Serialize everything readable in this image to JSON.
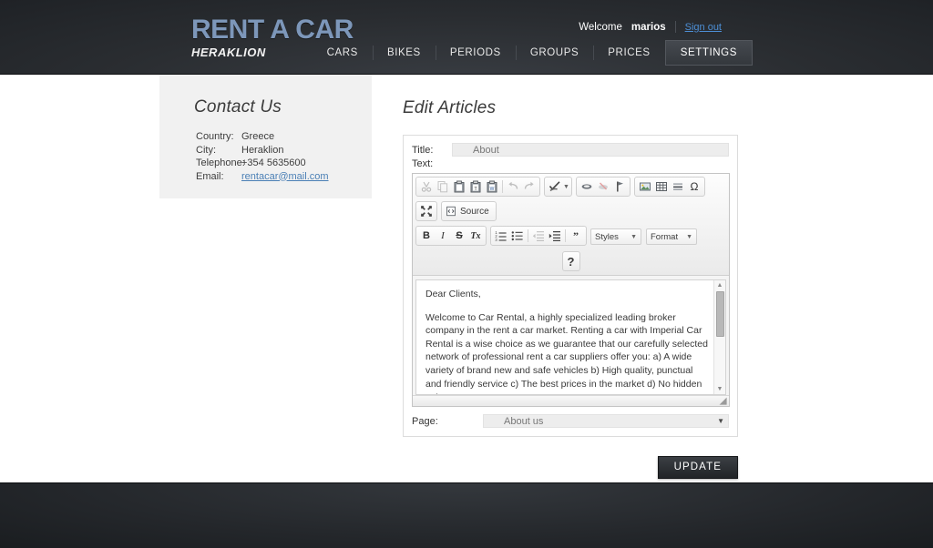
{
  "header": {
    "logo_main": "RENT A CAR",
    "logo_sub": "HERAKLION",
    "welcome_text": "Welcome",
    "welcome_user": "marios",
    "signout_label": "Sign out",
    "nav": [
      {
        "label": "CARS",
        "active": false
      },
      {
        "label": "BIKES",
        "active": false
      },
      {
        "label": "PERIODS",
        "active": false
      },
      {
        "label": "GROUPS",
        "active": false
      },
      {
        "label": "PRICES",
        "active": false
      },
      {
        "label": "SETTINGS",
        "active": true
      }
    ]
  },
  "sidebar": {
    "title": "Contact Us",
    "rows": [
      {
        "label": "Country:",
        "value": "Greece"
      },
      {
        "label": "City:",
        "value": "Heraklion"
      },
      {
        "label": "Telephone:",
        "value": "+354 5635600"
      }
    ],
    "email_label": "Email:",
    "email_value": "rentacar@mail.com"
  },
  "main": {
    "title": "Edit Articles",
    "title_field_label": "Title:",
    "title_field_value": "About",
    "text_field_label": "Text:",
    "page_field_label": "Page:",
    "page_field_value": "About us",
    "update_label": "UPDATE"
  },
  "editor": {
    "toolbar_row1": [
      {
        "name": "cut",
        "title": "Cut",
        "disabled": true
      },
      {
        "name": "copy",
        "title": "Copy",
        "disabled": true
      },
      {
        "name": "paste",
        "title": "Paste",
        "disabled": false
      },
      {
        "name": "paste-text",
        "title": "Paste as plain text",
        "disabled": false
      },
      {
        "name": "paste-word",
        "title": "Paste from Word",
        "disabled": false
      },
      {
        "name": "undo",
        "title": "Undo",
        "disabled": true
      },
      {
        "name": "redo",
        "title": "Redo",
        "disabled": true
      }
    ],
    "toolbar_spellcheck": {
      "name": "spell-check",
      "title": "Spell Check As You Type"
    },
    "toolbar_links": [
      {
        "name": "link",
        "title": "Link",
        "disabled": false
      },
      {
        "name": "unlink",
        "title": "Unlink",
        "disabled": true
      },
      {
        "name": "anchor",
        "title": "Anchor",
        "disabled": false
      }
    ],
    "toolbar_insert": [
      {
        "name": "image",
        "title": "Image",
        "disabled": false
      },
      {
        "name": "table",
        "title": "Table",
        "disabled": false
      },
      {
        "name": "horizontal-rule",
        "title": "Horizontal Line",
        "disabled": false
      },
      {
        "name": "special-char",
        "title": "Insert Special Character",
        "glyph": "Ω",
        "disabled": false
      }
    ],
    "toolbar_row2": {
      "maximize_title": "Maximize",
      "source_label": "Source"
    },
    "toolbar_row3_basic": [
      {
        "name": "bold",
        "glyph": "B",
        "title": "Bold"
      },
      {
        "name": "italic",
        "glyph": "I",
        "title": "Italic"
      },
      {
        "name": "strike",
        "glyph": "S",
        "title": "Strike Through"
      },
      {
        "name": "remove-format",
        "glyph": "Tx",
        "title": "Remove Format"
      }
    ],
    "toolbar_row3_para": [
      {
        "name": "numbered-list",
        "title": "Insert/Remove Numbered List",
        "disabled": false
      },
      {
        "name": "bulleted-list",
        "title": "Insert/Remove Bulleted List",
        "disabled": false
      },
      {
        "name": "outdent",
        "title": "Decrease Indent",
        "disabled": true
      },
      {
        "name": "indent",
        "title": "Increase Indent",
        "disabled": false
      },
      {
        "name": "blockquote",
        "title": "Block Quote",
        "disabled": false
      }
    ],
    "styles_combo_label": "Styles",
    "format_combo_label": "Format",
    "about_label": "?",
    "content_paragraphs": [
      "Dear Clients,",
      "Welcome to Car Rental, a highly specialized leading broker company in the rent a car market. Renting a car with Imperial Car Rental is a wise choice as we guarantee that our carefully selected network of professional rent a car suppliers offer you: a) A wide variety of brand new and safe vehicles b) High quality, punctual and friendly service c) The best prices in the market d) No hidden extras"
    ]
  },
  "colors": {
    "header_bg": "#2a2d31",
    "logo_blue": "#7d97ba",
    "link_blue": "#4a7fb5",
    "signout_blue": "#4d8fd6",
    "sidebar_bg": "#f1f1f1",
    "footer_bg": "#24272b",
    "update_btn": "#2b2e32"
  }
}
